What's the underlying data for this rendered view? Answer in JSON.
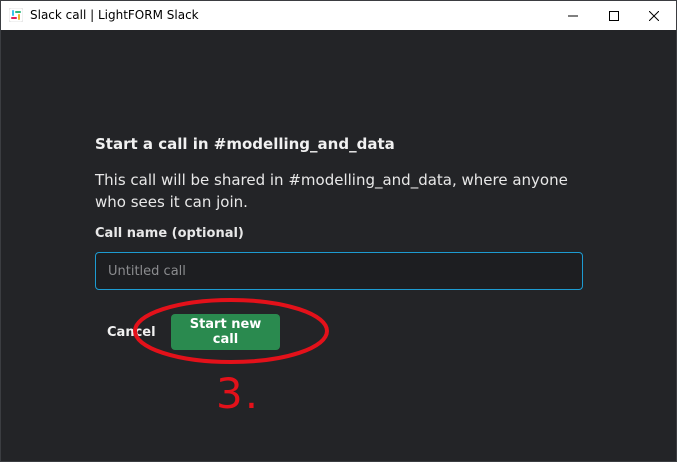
{
  "window": {
    "title": "Slack call | LightFORM Slack",
    "icon": "slack-app-icon",
    "controls": {
      "minimize": "minimize-icon",
      "maximize": "maximize-icon",
      "close": "close-icon"
    }
  },
  "dialog": {
    "title": "Start a call in #modelling_and_data",
    "description": "This call will be shared in #modelling_and_data, where anyone who sees it can join.",
    "field_label": "Call name (optional)",
    "call_name_value": "",
    "call_name_placeholder": "Untitled call",
    "cancel_label": "Cancel",
    "start_label": "Start new call"
  },
  "annotation": {
    "step_number": "3.",
    "color": "#e3111a"
  },
  "colors": {
    "background": "#232427",
    "primary_button": "#2a8a4f",
    "input_border": "#1d9bd1"
  }
}
